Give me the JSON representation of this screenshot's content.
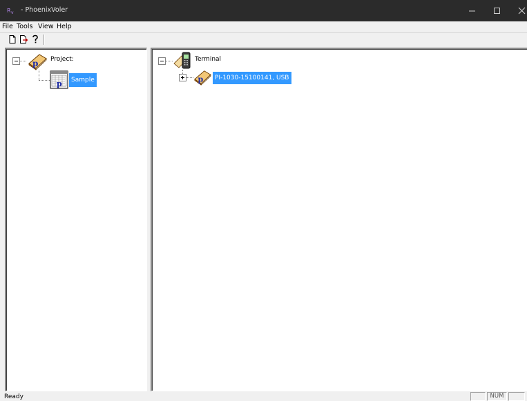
{
  "window": {
    "title": "- PhoenixVoler",
    "app_icon": "phoenix-app-icon"
  },
  "menu": [
    "File",
    "Tools",
    "View",
    "Help"
  ],
  "toolbar": {
    "buttons": [
      "new-document-icon",
      "open-document-icon",
      "help-icon"
    ]
  },
  "project_tree": {
    "root_label": "Project:",
    "child_label": "Sample"
  },
  "terminal_tree": {
    "root_label": "Terminal",
    "child_label": "PI-1030-15100141, USB"
  },
  "status": {
    "text": "Ready",
    "indicators": [
      "",
      "NUM",
      ""
    ]
  },
  "colors": {
    "titlebar": "#2b2b2b",
    "selection": "#3399ff"
  }
}
